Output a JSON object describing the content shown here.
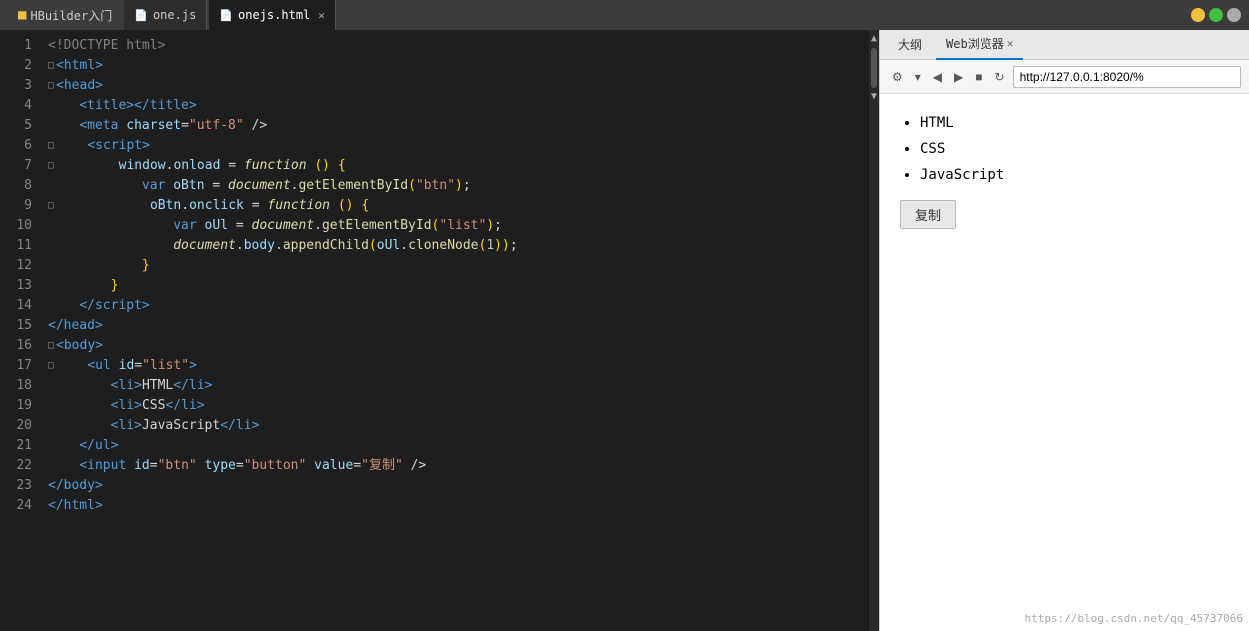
{
  "titlebar": {
    "app_title": "HBuilder入门",
    "tabs": [
      {
        "id": "one-js",
        "label": "one.js",
        "active": false,
        "closable": false
      },
      {
        "id": "onejs-html",
        "label": "onejs.html",
        "active": true,
        "closable": true
      }
    ],
    "window_buttons": {
      "minimize": "─",
      "maximize": "□",
      "close": "✕"
    }
  },
  "editor": {
    "lines": [
      {
        "num": "1",
        "collapsed": false,
        "content_html": "<span class='c-doctype'>&lt;!DOCTYPE html&gt;</span>"
      },
      {
        "num": "2",
        "collapsed": true,
        "content_html": "<span class='c-tag'>&lt;html&gt;</span>"
      },
      {
        "num": "3",
        "collapsed": true,
        "content_html": "<span class='c-tag'>&lt;head&gt;</span>"
      },
      {
        "num": "4",
        "collapsed": false,
        "content_html": "    <span class='c-tag'>&lt;title&gt;&lt;/title&gt;</span>"
      },
      {
        "num": "5",
        "collapsed": false,
        "content_html": "    <span class='c-tag'>&lt;meta</span> <span class='c-attr'>charset</span><span class='c-punct'>=</span><span class='c-value'>\"utf-8\"</span> <span class='c-punct'>/&gt;</span>"
      },
      {
        "num": "6",
        "collapsed": true,
        "content_html": "    <span class='c-tag'>&lt;script&gt;</span>"
      },
      {
        "num": "7",
        "collapsed": true,
        "content_html": "        <span class='c-var'>window</span><span class='c-punct'>.</span><span class='c-attr'>onload</span> <span class='c-punct'>=</span> <span class='c-italic'>function</span> <span class='c-bracket'>()</span> <span class='c-bracket'>{</span>"
      },
      {
        "num": "8",
        "collapsed": false,
        "content_html": "            <span class='c-keyword'>var</span> <span class='c-var'>oBtn</span> <span class='c-punct'>=</span> <span class='c-italic'>document</span><span class='c-punct'>.</span><span class='c-method'>getElementById</span><span class='c-bracket'>(</span><span class='c-string'>\"btn\"</span><span class='c-bracket'>)</span><span class='c-punct'>;</span>"
      },
      {
        "num": "9",
        "collapsed": true,
        "content_html": "            <span class='c-var'>oBtn</span><span class='c-punct'>.</span><span class='c-attr'>onclick</span> <span class='c-punct'>=</span> <span class='c-italic'>function</span> <span class='c-bracket'>()</span> <span class='c-bracket'>{</span>"
      },
      {
        "num": "10",
        "collapsed": false,
        "content_html": "                <span class='c-keyword'>var</span> <span class='c-var'>oUl</span> <span class='c-punct'>=</span> <span class='c-italic'>document</span><span class='c-punct'>.</span><span class='c-method'>getElementById</span><span class='c-bracket'>(</span><span class='c-string'>\"list\"</span><span class='c-bracket'>)</span><span class='c-punct'>;</span>"
      },
      {
        "num": "11",
        "collapsed": false,
        "content_html": "                <span class='c-italic'>document</span><span class='c-punct'>.</span><span class='c-var'>body</span><span class='c-punct'>.</span><span class='c-method'>appendChild</span><span class='c-bracket'>(</span><span class='c-var'>oUl</span><span class='c-punct'>.</span><span class='c-method'>cloneNode</span><span class='c-bracket'>(</span><span class='c-num'>1</span><span class='c-bracket'>))</span><span class='c-punct'>;</span>"
      },
      {
        "num": "12",
        "collapsed": false,
        "content_html": "            <span class='c-bracket'>}</span>"
      },
      {
        "num": "13",
        "collapsed": false,
        "content_html": "        <span class='c-bracket'>}</span>"
      },
      {
        "num": "14",
        "collapsed": false,
        "content_html": "    <span class='c-tag'>&lt;/script&gt;</span>"
      },
      {
        "num": "15",
        "collapsed": false,
        "content_html": "<span class='c-tag'>&lt;/head&gt;</span>"
      },
      {
        "num": "16",
        "collapsed": true,
        "content_html": "<span class='c-tag'>&lt;body&gt;</span>"
      },
      {
        "num": "17",
        "collapsed": true,
        "content_html": "    <span class='c-tag'>&lt;ul</span> <span class='c-attr'>id</span><span class='c-punct'>=</span><span class='c-value'>\"list\"</span><span class='c-tag'>&gt;</span>"
      },
      {
        "num": "18",
        "collapsed": false,
        "content_html": "        <span class='c-tag'>&lt;li&gt;</span><span class='c-white'>HTML</span><span class='c-tag'>&lt;/li&gt;</span>"
      },
      {
        "num": "19",
        "collapsed": false,
        "content_html": "        <span class='c-tag'>&lt;li&gt;</span><span class='c-white'>CSS</span><span class='c-tag'>&lt;/li&gt;</span>"
      },
      {
        "num": "20",
        "collapsed": false,
        "content_html": "        <span class='c-tag'>&lt;li&gt;</span><span class='c-white'>JavaScript</span><span class='c-tag'>&lt;/li&gt;</span>"
      },
      {
        "num": "21",
        "collapsed": false,
        "content_html": "    <span class='c-tag'>&lt;/ul&gt;</span>"
      },
      {
        "num": "22",
        "collapsed": false,
        "content_html": "    <span class='c-tag'>&lt;input</span> <span class='c-attr'>id</span><span class='c-punct'>=</span><span class='c-value'>\"btn\"</span> <span class='c-attr'>type</span><span class='c-punct'>=</span><span class='c-value'>\"button\"</span> <span class='c-attr'>value</span><span class='c-punct'>=</span><span class='c-value'>\"复制\"</span> <span class='c-punct'>/&gt;</span>"
      },
      {
        "num": "23",
        "collapsed": false,
        "content_html": "<span class='c-tag'>&lt;/body&gt;</span>"
      },
      {
        "num": "24",
        "collapsed": false,
        "content_html": "<span class='c-tag'>&lt;/html&gt;</span>"
      }
    ]
  },
  "right_panel": {
    "outline_tab_label": "大纲",
    "browser_tab_label": "Web浏览器",
    "address_bar_value": "http://127.0.0.1:8020/%",
    "browser_list_items": [
      "HTML",
      "CSS",
      "JavaScript"
    ],
    "copy_button_label": "复制",
    "watermark": "https://blog.csdn.net/qq_45737066",
    "toolbar_buttons": [
      "⚙",
      "▼",
      "◁",
      "▷",
      "□",
      "↻"
    ]
  }
}
